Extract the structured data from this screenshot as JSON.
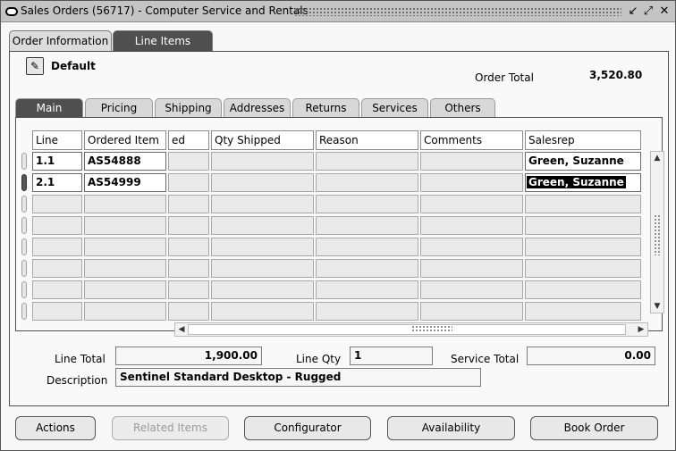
{
  "window": {
    "title": "Sales Orders (56717) - Computer Service and Rentals",
    "controls": [
      "↙",
      "⤢",
      "✕"
    ]
  },
  "top_tabs": [
    {
      "label": "Order Information",
      "active": false
    },
    {
      "label": "Line Items",
      "active": true
    }
  ],
  "header": {
    "folder_label": "Default",
    "order_total_label": "Order Total",
    "order_total_value": "3,520.80"
  },
  "sub_tabs": [
    {
      "label": "Main",
      "active": true
    },
    {
      "label": "Pricing",
      "active": false
    },
    {
      "label": "Shipping",
      "active": false
    },
    {
      "label": "Addresses",
      "active": false
    },
    {
      "label": "Returns",
      "active": false
    },
    {
      "label": "Services",
      "active": false
    },
    {
      "label": "Others",
      "active": false
    }
  ],
  "grid": {
    "columns": [
      "Line",
      "Ordered Item",
      "ed",
      "Qty Shipped",
      "Reason",
      "Comments",
      "Salesrep"
    ],
    "rows": [
      [
        "1.1",
        "AS54888",
        "",
        "",
        "",
        "",
        "Green, Suzanne"
      ],
      [
        "2.1",
        "AS54999",
        "",
        "",
        "",
        "",
        "Green, Suzanne"
      ],
      [
        "",
        "",
        "",
        "",
        "",
        "",
        ""
      ],
      [
        "",
        "",
        "",
        "",
        "",
        "",
        ""
      ],
      [
        "",
        "",
        "",
        "",
        "",
        "",
        ""
      ],
      [
        "",
        "",
        "",
        "",
        "",
        "",
        ""
      ],
      [
        "",
        "",
        "",
        "",
        "",
        "",
        ""
      ],
      [
        "",
        "",
        "",
        "",
        "",
        "",
        ""
      ]
    ]
  },
  "summary": {
    "line_total_label": "Line Total",
    "line_total_value": "1,900.00",
    "line_qty_label": "Line Qty",
    "line_qty_value": "1",
    "service_total_label": "Service Total",
    "service_total_value": "0.00",
    "description_label": "Description",
    "description_value": "Sentinel Standard Desktop - Rugged"
  },
  "buttons": {
    "actions": "Actions",
    "related_items": "Related Items",
    "configurator": "Configurator",
    "availability": "Availability",
    "book_order": "Book Order"
  }
}
